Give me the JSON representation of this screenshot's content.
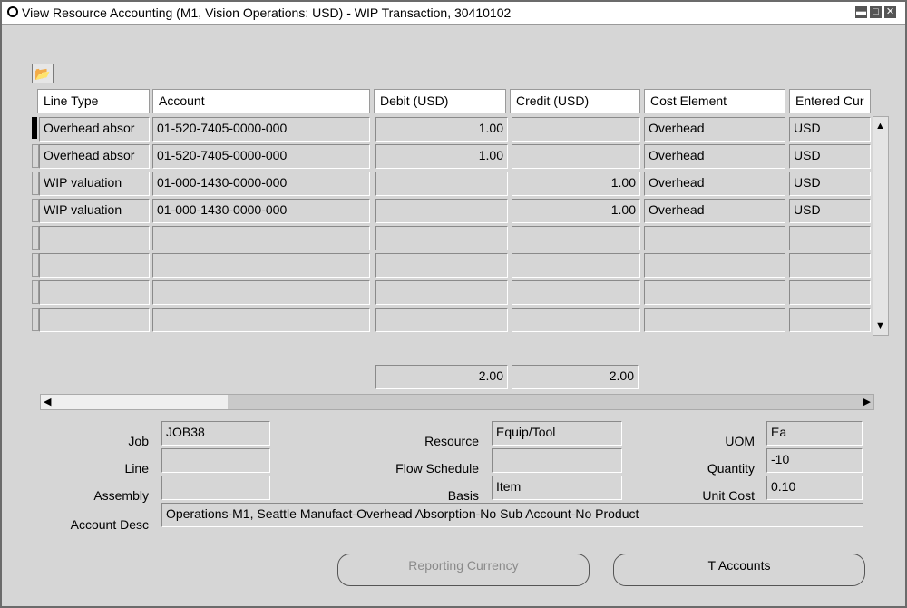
{
  "window": {
    "title": "View Resource Accounting (M1, Vision Operations: USD) - WIP Transaction, 30410102"
  },
  "table": {
    "headers": [
      "Line Type",
      "Account",
      "Debit (USD)",
      "Credit (USD)",
      "Cost Element",
      "Entered Cur"
    ],
    "rows": [
      {
        "line_type": "Overhead absor",
        "account": "01-520-7405-0000-000",
        "debit": "1.00",
        "credit": "",
        "cost_element": "Overhead",
        "currency": "USD"
      },
      {
        "line_type": "Overhead absor",
        "account": "01-520-7405-0000-000",
        "debit": "1.00",
        "credit": "",
        "cost_element": "Overhead",
        "currency": "USD"
      },
      {
        "line_type": "WIP valuation",
        "account": "01-000-1430-0000-000",
        "debit": "",
        "credit": "1.00",
        "cost_element": "Overhead",
        "currency": "USD"
      },
      {
        "line_type": "WIP valuation",
        "account": "01-000-1430-0000-000",
        "debit": "",
        "credit": "1.00",
        "cost_element": "Overhead",
        "currency": "USD"
      },
      {
        "line_type": "",
        "account": "",
        "debit": "",
        "credit": "",
        "cost_element": "",
        "currency": ""
      },
      {
        "line_type": "",
        "account": "",
        "debit": "",
        "credit": "",
        "cost_element": "",
        "currency": ""
      },
      {
        "line_type": "",
        "account": "",
        "debit": "",
        "credit": "",
        "cost_element": "",
        "currency": ""
      },
      {
        "line_type": "",
        "account": "",
        "debit": "",
        "credit": "",
        "cost_element": "",
        "currency": ""
      }
    ],
    "total_debit": "2.00",
    "total_credit": "2.00"
  },
  "details": {
    "job_label": "Job",
    "job_value": "JOB38",
    "line_label": "Line",
    "line_value": "",
    "assembly_label": "Assembly",
    "assembly_value": "",
    "account_desc_label": "Account Desc",
    "account_desc_value": "Operations-M1, Seattle Manufact-Overhead Absorption-No Sub Account-No Product",
    "resource_label": "Resource",
    "resource_value": "Equip/Tool",
    "flow_schedule_label": "Flow Schedule",
    "flow_schedule_value": "",
    "basis_label": "Basis",
    "basis_value": "Item",
    "uom_label": "UOM",
    "uom_value": "Ea",
    "quantity_label": "Quantity",
    "quantity_value": "-10",
    "unit_cost_label": "Unit Cost",
    "unit_cost_value": "0.10"
  },
  "buttons": {
    "reporting_currency": "Reporting Currency",
    "t_accounts": "T Accounts"
  }
}
